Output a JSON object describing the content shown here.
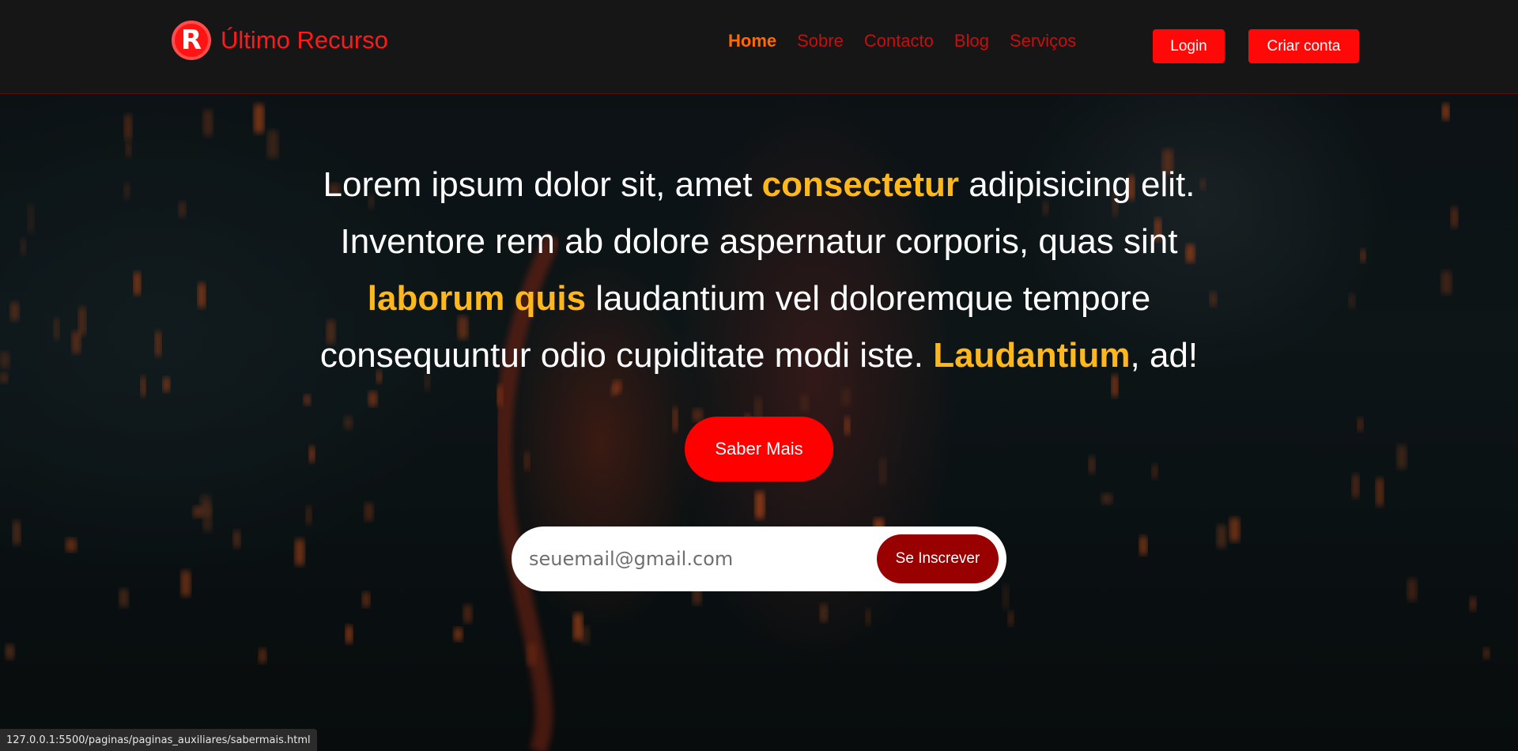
{
  "colors": {
    "accent_red": "#ff0808",
    "highlight_yellow": "#ffb81c",
    "active_nav": "#ff6a00",
    "nav_link": "#c80e0e",
    "subscribe_button": "#990000"
  },
  "brand": {
    "logo_letter": "R",
    "name": "Último Recurso"
  },
  "nav": {
    "links": [
      {
        "label": "Home",
        "active": true
      },
      {
        "label": "Sobre",
        "active": false
      },
      {
        "label": "Contacto",
        "active": false
      },
      {
        "label": "Blog",
        "active": false
      },
      {
        "label": "Serviços",
        "active": false
      }
    ],
    "login_label": "Login",
    "signup_label": "Criar conta"
  },
  "hero": {
    "text_parts": [
      {
        "text": "Lorem ipsum dolor sit, amet ",
        "highlight": false
      },
      {
        "text": "consectetur",
        "highlight": true
      },
      {
        "text": " adipisicing elit. Inventore rem ab dolore aspernatur corporis, quas sint ",
        "highlight": false
      },
      {
        "text": "laborum quis",
        "highlight": true
      },
      {
        "text": " laudantium vel doloremque tempore consequuntur odio cupiditate modi iste. ",
        "highlight": false
      },
      {
        "text": "Laudantium",
        "highlight": true
      },
      {
        "text": ", ad!",
        "highlight": false
      }
    ],
    "cta_label": "Saber Mais"
  },
  "subscribe": {
    "placeholder": "seuemail@gmail.com",
    "value": "",
    "button_label": "Se Inscrever"
  },
  "status_bar": {
    "url": "127.0.0.1:5500/paginas/paginas_auxiliares/sabermais.html"
  }
}
